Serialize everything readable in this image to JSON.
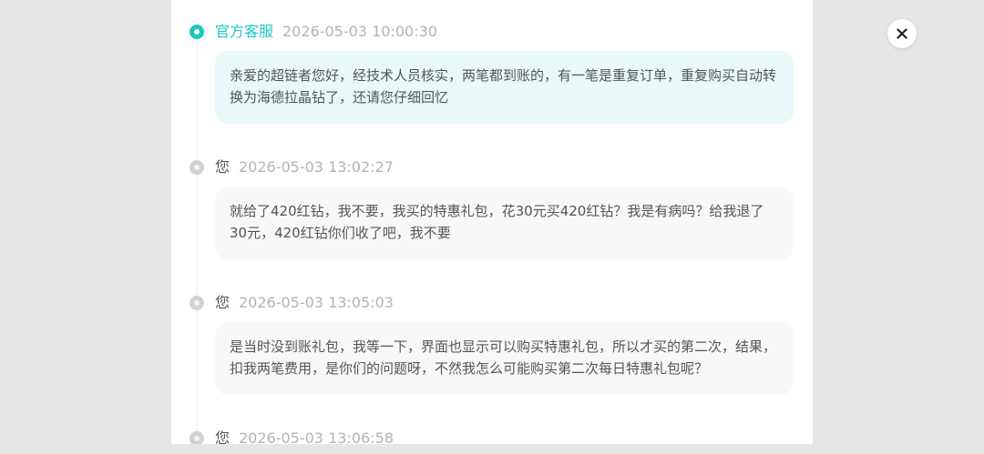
{
  "messages": [
    {
      "sender": "官方客服",
      "role": "agent",
      "timestamp": "2026-05-03 10:00:30",
      "text": "亲爱的超链者您好，经技术人员核实，两笔都到账的，有一笔是重复订单，重复购买自动转换为海德拉晶钻了，还请您仔细回忆"
    },
    {
      "sender": "您",
      "role": "user",
      "timestamp": "2026-05-03 13:02:27",
      "text": "就给了420红钻，我不要，我买的特惠礼包，花30元买420红钻？我是有病吗？给我退了30元，420红钻你们收了吧，我不要"
    },
    {
      "sender": "您",
      "role": "user",
      "timestamp": "2026-05-03 13:05:03",
      "text": "是当时没到账礼包，我等一下，界面也显示可以购买特惠礼包，所以才买的第二次，结果，扣我两笔费用，是你们的问题呀，不然我怎么可能购买第二次每日特惠礼包呢？"
    },
    {
      "sender": "您",
      "role": "user",
      "timestamp": "2026-05-03 13:06:58",
      "text": ""
    }
  ],
  "close_icon": "close-icon",
  "colors": {
    "accent": "#1ec8bf",
    "agent_bubble": "#eaf8f9",
    "user_bubble": "#f8f8f8",
    "timestamp": "#b3b3b3",
    "backdrop": "#e6e6e6"
  }
}
